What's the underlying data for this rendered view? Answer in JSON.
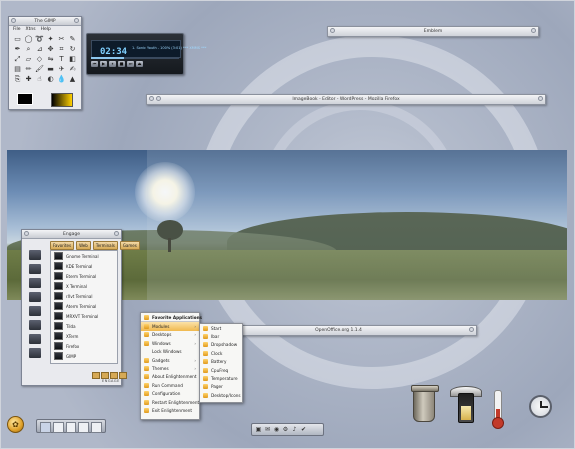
{
  "gimp": {
    "title": "The GIMP",
    "menu": [
      "File",
      "Xtns",
      "Help"
    ]
  },
  "xmms": {
    "time": "02:34",
    "track": "1. Sonic Youth - 100% (3:01) *** XMMS ***"
  },
  "windows": {
    "emblem": "Emblem",
    "imagebook": "ImageBook - Editor - WordPress - Mozilla Firefox",
    "openoffice": "OpenOffice.org 1.1.4"
  },
  "launcher": {
    "title": "Engage",
    "tabs": [
      "Favorites",
      "Web",
      "Terminals",
      "Games"
    ],
    "items": [
      "Gnome Terminal",
      "KDE Terminal",
      "Eterm Terminal",
      "X Terminal",
      "rXvt Terminal",
      "Aterm Terminal",
      "MRXVT Terminal",
      "Tilda",
      "XTerm",
      "Firefox",
      "GIMP"
    ],
    "brand": "ENGAGE"
  },
  "favorites_menu": {
    "header": "Favorite Applications",
    "items": [
      "Modules",
      "Desktops",
      "Windows",
      "Lock Windows",
      "Gadgets",
      "Themes",
      "About Enlightenment",
      "Run Command",
      "Configuration",
      "Restart Enlightenment",
      "Exit Enlightenment"
    ]
  },
  "modules_menu": {
    "items": [
      "Start",
      "Ibar",
      "Dropshadow",
      "Clock",
      "Battery",
      "CpuFreq",
      "Temperature",
      "Pager",
      "Desktop/Icons"
    ]
  },
  "pager": {
    "desktops": 5,
    "current": 1
  },
  "iconbox": {
    "icons": [
      "terminal-icon",
      "mail-icon",
      "web-icon",
      "gear-icon",
      "music-icon",
      "check-icon"
    ]
  },
  "battery": {
    "level": 0.6
  },
  "temperature": {
    "level": 0.4
  },
  "colors": {
    "accent": "#f0b94e",
    "desktop": "#b4bccc"
  }
}
